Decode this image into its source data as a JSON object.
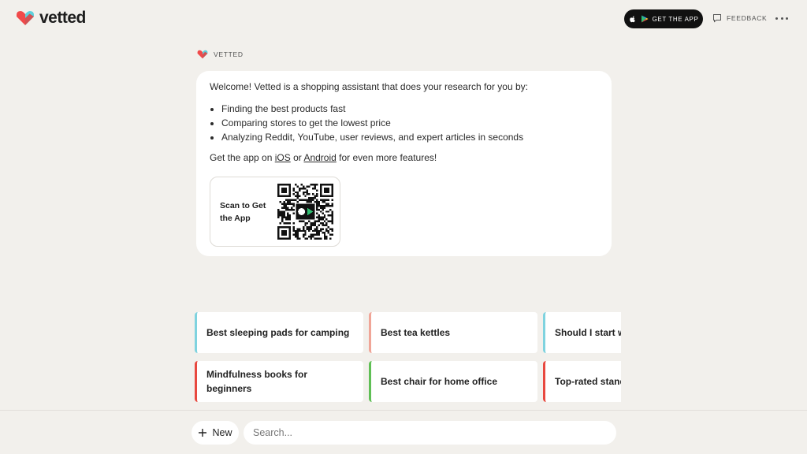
{
  "app": {
    "brand_name": "vetted"
  },
  "header": {
    "get_app_label": "GET THE APP",
    "feedback_label": "FEEDBACK",
    "more_icon": "more-horizontal-icon"
  },
  "message": {
    "sender": "VETTED",
    "intro": "Welcome! Vetted is a shopping assistant that does your research for you by:",
    "bullets": [
      "Finding the best products fast",
      "Comparing stores to get the lowest price",
      "Analyzing Reddit, YouTube, user reviews, and expert articles in seconds"
    ],
    "app_line_prefix": "Get the app on ",
    "ios_link": "iOS",
    "or_text": " or ",
    "android_link": "Android",
    "app_line_suffix": " for even more features!",
    "qr_label": "Scan to Get the App"
  },
  "suggestions": {
    "row1": [
      "Best sleeping pads for camping",
      "Best tea kettles",
      "Should I start with paints?"
    ],
    "row2": [
      "Mindfulness books for beginners",
      "Best chair for home office",
      "Top-rated standalone novels"
    ],
    "row1_colors": [
      "#7fd3df",
      "#f0a597",
      "#7fd3df"
    ],
    "row2_colors": [
      "#e8483f",
      "#5fbf55",
      "#e8483f"
    ]
  },
  "composer": {
    "new_label": "New",
    "search_placeholder": "Search..."
  },
  "colors": {
    "brand_red": "#f04a4a",
    "brand_cyan": "#5fd0dc",
    "background": "#f2f0ec"
  }
}
